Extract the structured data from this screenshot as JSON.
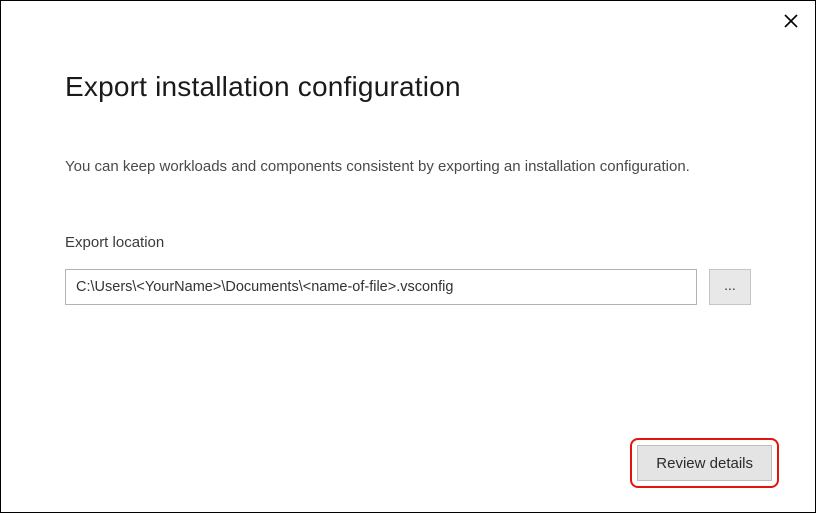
{
  "dialog": {
    "title": "Export installation configuration",
    "description": "You can keep workloads and components consistent by exporting an installation configuration.",
    "fieldLabel": "Export location",
    "pathValue": "C:\\Users\\<YourName>\\Documents\\<name-of-file>.vsconfig",
    "browseLabel": "...",
    "reviewLabel": "Review details"
  }
}
